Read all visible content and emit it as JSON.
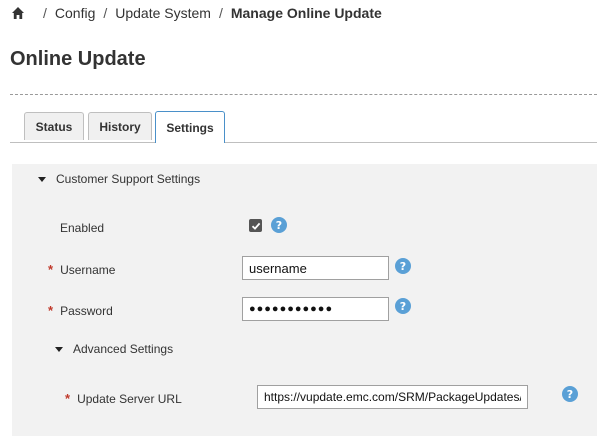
{
  "breadcrumb": {
    "home_icon": "home-icon",
    "separator": "/",
    "items": [
      "Config",
      "Update System"
    ],
    "current": "Manage Online Update"
  },
  "page": {
    "title": "Online Update"
  },
  "tabs": [
    {
      "label": "Status",
      "active": false
    },
    {
      "label": "History",
      "active": false
    },
    {
      "label": "Settings",
      "active": true
    }
  ],
  "customer_support": {
    "section_label": "Customer Support Settings",
    "expanded": true,
    "enabled": {
      "label": "Enabled",
      "checked": true
    },
    "username": {
      "label": "Username",
      "required": "*",
      "value": "username"
    },
    "password": {
      "label": "Password",
      "required": "*",
      "value": "●●●●●●●●●●●"
    },
    "help_icon": "question-circle-icon"
  },
  "advanced": {
    "section_label": "Advanced Settings",
    "expanded": true,
    "update_server_url": {
      "label": "Update Server URL",
      "required": "*",
      "value": "https://vupdate.emc.com/SRM/PackageUpdates/"
    }
  },
  "colors": {
    "active_tab_border": "#4a90c9",
    "help_icon": "#5aa0d6",
    "required_marker": "#c0392b",
    "panel_bg": "#f2f2f2"
  }
}
